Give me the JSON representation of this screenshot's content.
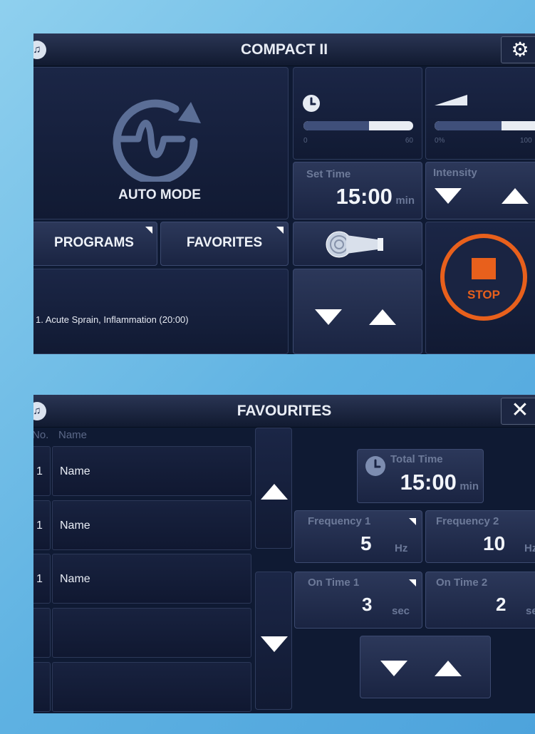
{
  "compact": {
    "title": "COMPACT II",
    "logo_glyph": "⃡",
    "gear_icon": "gear-icon",
    "mode_label": "AUTO MODE",
    "timer": {
      "tick_min": "0",
      "tick_max": "60",
      "level": 0.6
    },
    "intensity": {
      "tick_min": "0%",
      "tick_max": "100",
      "level": 0.55
    },
    "set_time": {
      "label": "Set Time",
      "value": "15:00",
      "unit": "min"
    },
    "intensity_control": {
      "label": "Intensity"
    },
    "programs_label": "PROGRAMS",
    "favorites_label": "FAVORITES",
    "stop_label": "STOP",
    "program_text": "1. Acute Sprain, Inflammation (20:00)",
    "accent_color": "#e8601c"
  },
  "favourites": {
    "title": "FAVOURITES",
    "close_glyph": "✕",
    "header_no": "No.",
    "header_name": "Name",
    "rows": [
      {
        "no": "1",
        "name": "Name"
      },
      {
        "no": "1",
        "name": "Name"
      },
      {
        "no": "1",
        "name": "Name"
      },
      {
        "no": "",
        "name": ""
      },
      {
        "no": "",
        "name": ""
      }
    ],
    "total_time": {
      "label": "Total Time",
      "value": "15:00",
      "unit": "min"
    },
    "frequency1": {
      "label": "Frequency 1",
      "value": "5",
      "unit": "Hz"
    },
    "frequency2": {
      "label": "Frequency 2",
      "value": "10",
      "unit": "Hz"
    },
    "on_time1": {
      "label": "On Time 1",
      "value": "3",
      "unit": "sec"
    },
    "on_time2": {
      "label": "On Time 2",
      "value": "2",
      "unit": "sec"
    }
  }
}
